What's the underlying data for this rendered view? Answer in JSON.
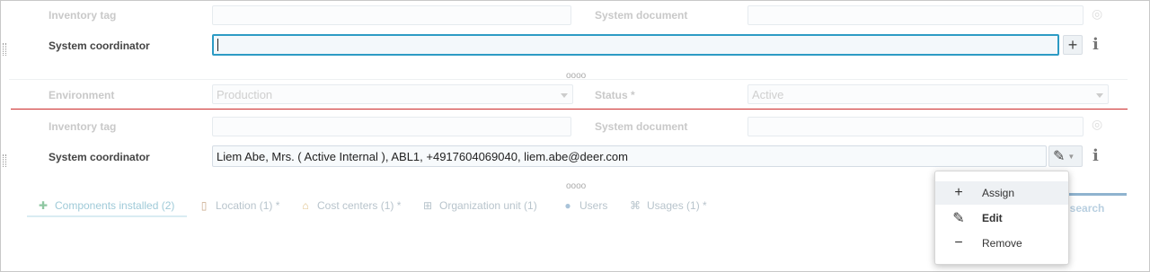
{
  "top_section": {
    "inventory_tag_label": "Inventory tag",
    "system_document_label": "System document",
    "system_coordinator_label": "System coordinator",
    "system_coordinator_value": "",
    "dots": "oooo"
  },
  "middle_section": {
    "environment_label": "Environment",
    "environment_value": "Production",
    "status_label": "Status *",
    "status_value": "Active",
    "inventory_tag_label": "Inventory tag",
    "system_document_label": "System document",
    "system_coordinator_label": "System coordinator",
    "system_coordinator_value": "Liem Abe, Mrs. ( Active Internal ), ABL1, +4917604069040, liem.abe@deer.com",
    "dots": "oooo"
  },
  "tabs": [
    {
      "label": "Components installed (2)",
      "icon": "puzzle-icon"
    },
    {
      "label": "Location (1) *",
      "icon": "location-icon"
    },
    {
      "label": "Cost centers (1) *",
      "icon": "bank-icon"
    },
    {
      "label": "Organization unit (1)",
      "icon": "org-chart-icon"
    },
    {
      "label": "Users",
      "icon": "user-icon"
    },
    {
      "label": "Usages (1) *",
      "icon": "usages-icon"
    }
  ],
  "view_search_label": "w search",
  "context_menu": {
    "items": [
      {
        "label": "Assign",
        "icon": "plus-icon"
      },
      {
        "label": "Edit",
        "icon": "pencil-icon"
      },
      {
        "label": "Remove",
        "icon": "minus-icon"
      }
    ]
  },
  "icons": {
    "add": "+",
    "info": "i",
    "edit": "✎"
  },
  "colors": {
    "accent": "#2d9bc4",
    "separator": "#cc2b2b"
  }
}
